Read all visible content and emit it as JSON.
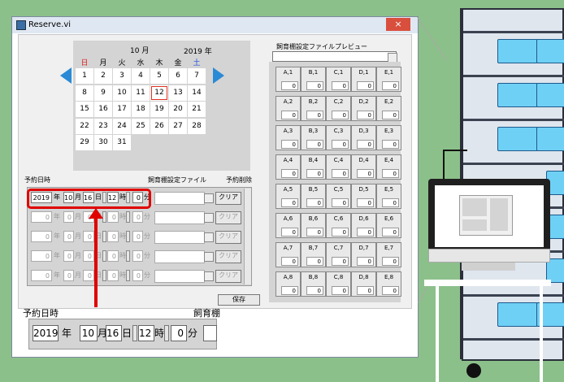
{
  "window": {
    "title": "Reserve.vi",
    "close_glyph": "×"
  },
  "calendar": {
    "month_label": "10 月",
    "year_label": "2019 年",
    "weekdays": [
      "日",
      "月",
      "火",
      "水",
      "木",
      "金",
      "土"
    ],
    "weekday_colors": {
      "sunday": "#e02020",
      "saturday": "#2050e0"
    },
    "days": [
      [
        "",
        "1",
        "2",
        "3",
        "4",
        "5",
        "6",
        "7"
      ],
      [
        "8",
        "9",
        "10",
        "11",
        "12",
        "13",
        "14"
      ],
      [
        "15",
        "16",
        "17",
        "18",
        "19",
        "20",
        "21"
      ],
      [
        "22",
        "23",
        "24",
        "25",
        "26",
        "27",
        "28"
      ],
      [
        "29",
        "30",
        "31",
        "",
        "",
        "",
        ""
      ],
      [
        "",
        "",
        "",
        "",
        "",
        "",
        ""
      ]
    ],
    "today": "12",
    "arrow_color": "#2a8ad6"
  },
  "reservations": {
    "header_date": "予約日時",
    "header_file": "飼育棚設定ファイル",
    "header_delete": "予約削除",
    "rows": [
      {
        "year": "2019",
        "month": "10",
        "day": "16",
        "hour": "12",
        "minute": "0",
        "enabled": true
      },
      {
        "year": "0",
        "month": "0",
        "day": "0",
        "hour": "0",
        "minute": "0",
        "enabled": false
      },
      {
        "year": "0",
        "month": "0",
        "day": "0",
        "hour": "0",
        "minute": "0",
        "enabled": false
      },
      {
        "year": "0",
        "month": "0",
        "day": "0",
        "hour": "0",
        "minute": "0",
        "enabled": false
      },
      {
        "year": "0",
        "month": "0",
        "day": "0",
        "hour": "0",
        "minute": "0",
        "enabled": false
      }
    ],
    "unit_year": "年",
    "unit_month": "月",
    "unit_day": "日",
    "unit_hour": "時",
    "unit_minute": "分",
    "clear_label": "クリア",
    "save_label": "保存"
  },
  "preview": {
    "title": "飼育棚設定ファイルプレビュー",
    "columns": [
      "A",
      "B",
      "C",
      "D",
      "E"
    ],
    "rows": [
      "1",
      "2",
      "3",
      "4",
      "5",
      "6",
      "7",
      "8"
    ],
    "value": "0"
  },
  "zoom": {
    "label_date": "予約日時",
    "label_file": "飼育棚",
    "year": "2019",
    "month": "10",
    "day": "16",
    "hour": "12",
    "minute": "0",
    "unit_year": "年",
    "unit_month": "月",
    "unit_day": "日",
    "unit_hour": "時",
    "unit_minute": "分"
  },
  "colors": {
    "highlight": "#e00000",
    "background": "#8cc08a",
    "bin": "#6fd0f5"
  }
}
